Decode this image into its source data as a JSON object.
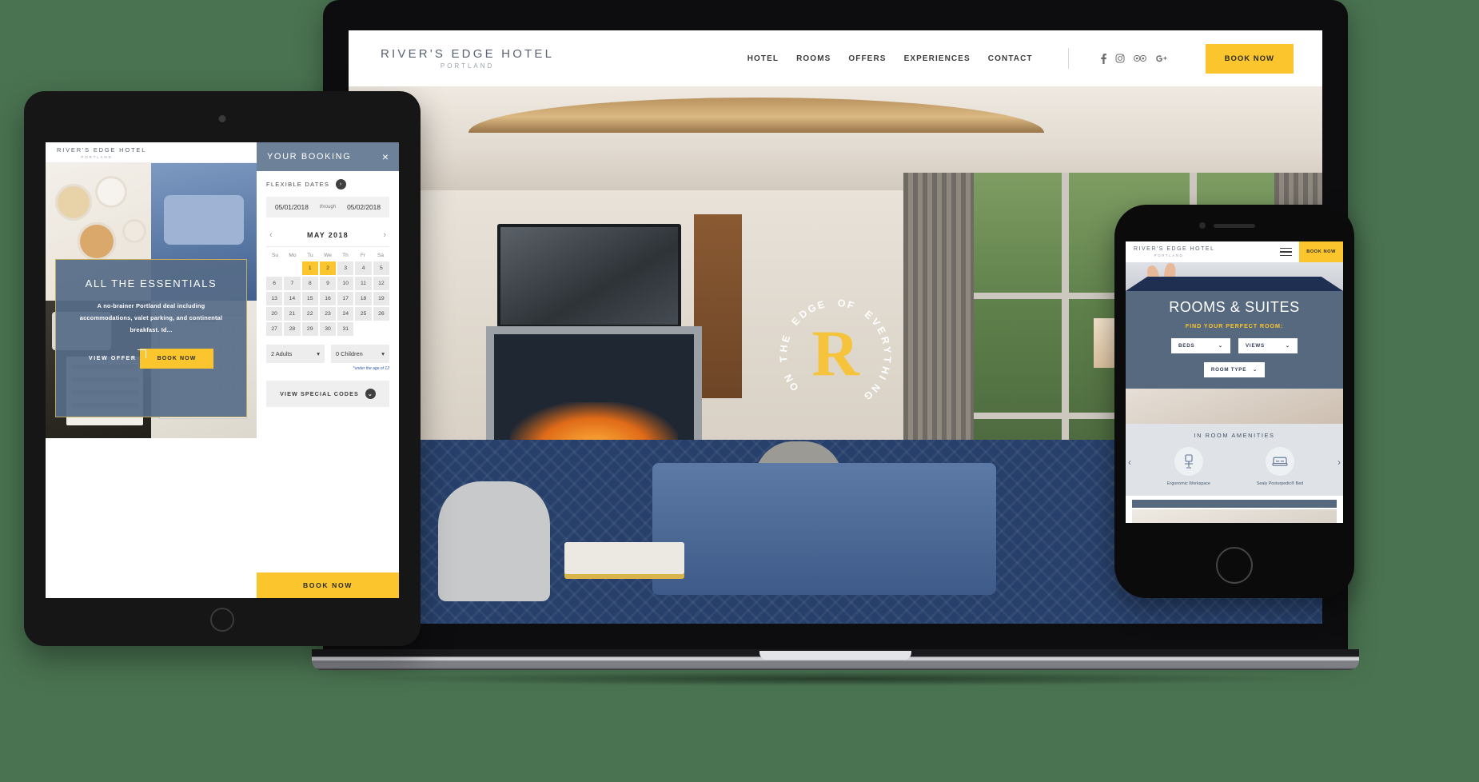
{
  "background_color": "#4a7351",
  "brand": {
    "name": "RIVER'S EDGE HOTEL",
    "location": "PORTLAND",
    "accent_yellow": "#fbc52d",
    "accent_blue": "#56697f"
  },
  "laptop": {
    "header": {
      "logo_name": "RIVER'S EDGE HOTEL",
      "logo_sub": "PORTLAND",
      "nav": [
        {
          "label": "HOTEL"
        },
        {
          "label": "ROOMS"
        },
        {
          "label": "OFFERS"
        },
        {
          "label": "EXPERIENCES"
        },
        {
          "label": "CONTACT"
        }
      ],
      "social": [
        {
          "name": "facebook-icon",
          "glyph": "f"
        },
        {
          "name": "instagram-icon",
          "glyph": "▢"
        },
        {
          "name": "tripadvisor-icon",
          "glyph": "∞"
        },
        {
          "name": "googleplus-icon",
          "glyph": "G+"
        }
      ],
      "book_now": "BOOK NOW"
    },
    "hero_badge": {
      "ring_text": "ON THE EDGE OF EVERYTHING",
      "monogram": "R"
    }
  },
  "tablet": {
    "header": {
      "logo_name": "RIVER'S EDGE HOTEL",
      "logo_sub": "PORTLAND"
    },
    "offer_card": {
      "title": "ALL THE ESSENTIALS",
      "description": "A no-brainer Portland deal including accommodations, valet parking, and continental breakfast. Id...",
      "view_offer": "VIEW OFFER",
      "book_now": "BOOK NOW"
    },
    "booking_panel": {
      "title": "YOUR BOOKING",
      "close_icon": "×",
      "flexible_dates_label": "FLEXIBLE DATES",
      "flexible_dates_icon": "›",
      "check_in": "05/01/2018",
      "through_label": "through",
      "check_out": "05/02/2018",
      "calendar": {
        "month_label": "MAY 2018",
        "prev_icon": "‹",
        "next_icon": "›",
        "day_headers": [
          "Su",
          "Mo",
          "Tu",
          "We",
          "Th",
          "Fr",
          "Sa"
        ],
        "leading_blanks": 2,
        "days": [
          1,
          2,
          3,
          4,
          5,
          6,
          7,
          8,
          9,
          10,
          11,
          12,
          13,
          14,
          15,
          16,
          17,
          18,
          19,
          20,
          21,
          22,
          23,
          24,
          25,
          26,
          27,
          28,
          29,
          30,
          31
        ],
        "selected_days": [
          1,
          2
        ]
      },
      "adults_select": "2 Adults",
      "children_select": "0 Children",
      "children_note": "*under the age of 12",
      "special_codes_label": "VIEW SPECIAL CODES",
      "special_codes_icon": "⌄",
      "footer_book_now": "BOOK NOW"
    }
  },
  "phone": {
    "header": {
      "logo_name": "RIVER'S EDGE HOTEL",
      "logo_sub": "PORTLAND",
      "menu_icon": "hamburger-icon",
      "book_now": "BOOK NOW"
    },
    "rooms_section": {
      "title": "ROOMS & SUITES",
      "subtitle": "FIND YOUR PERFECT ROOM:",
      "filters": [
        {
          "label": "BEDS"
        },
        {
          "label": "VIEWS"
        },
        {
          "label": "ROOM TYPE"
        }
      ],
      "chevron_icon": "⌄"
    },
    "amenities": {
      "title": "IN ROOM AMENITIES",
      "prev_icon": "‹",
      "next_icon": "›",
      "items": [
        {
          "label": "Ergonomic Workspace",
          "icon": "office-chair-icon"
        },
        {
          "label": "Sealy Posturpedic® Bed",
          "icon": "bed-icon"
        }
      ]
    }
  }
}
